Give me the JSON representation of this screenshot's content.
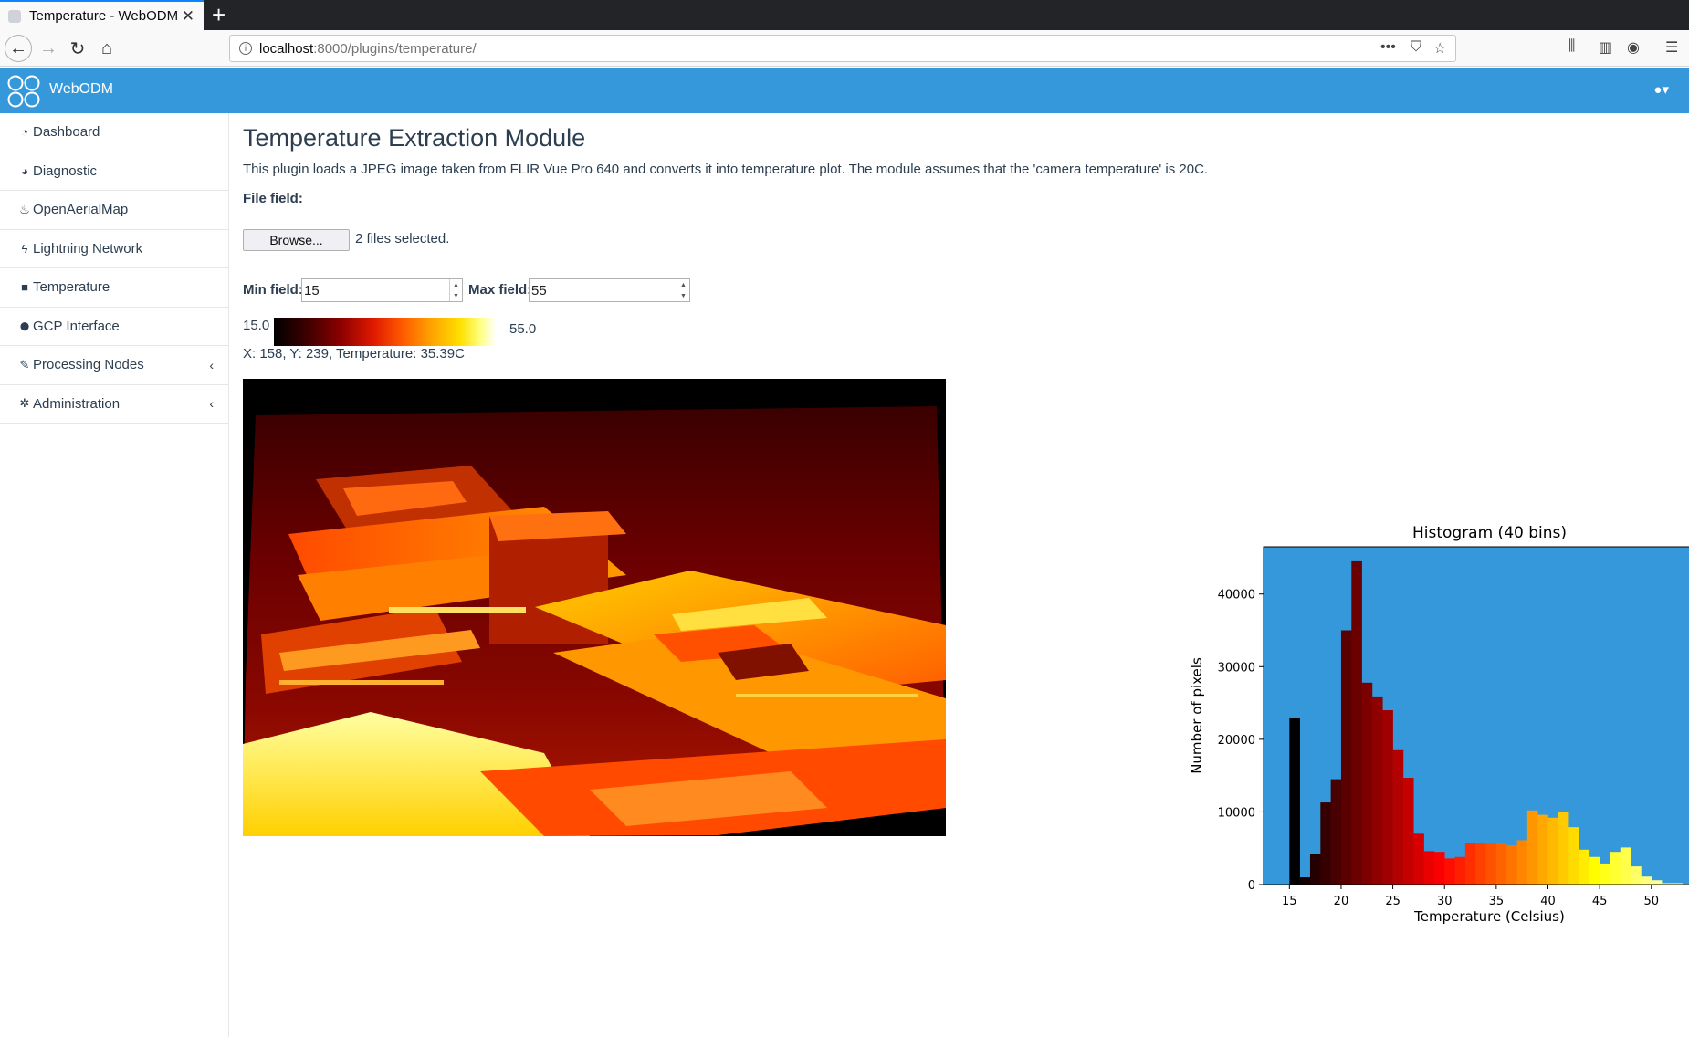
{
  "browser": {
    "tab_title": "Temperature - WebODM",
    "url_host": "localhost",
    "url_path": ":8000/plugins/temperature/"
  },
  "app": {
    "brand": "WebODM"
  },
  "sidebar": {
    "items": [
      {
        "label": "Dashboard",
        "icon": "dashboard-icon",
        "glyph": "◔"
      },
      {
        "label": "Diagnostic",
        "icon": "pie-chart-icon",
        "glyph": "◕"
      },
      {
        "label": "OpenAerialMap",
        "icon": "fire-icon",
        "glyph": "♨"
      },
      {
        "label": "Lightning Network",
        "icon": "bolt-icon",
        "glyph": "ϟ"
      },
      {
        "label": "Temperature",
        "icon": "camera-icon",
        "glyph": "■"
      },
      {
        "label": "GCP Interface",
        "icon": "map-marker-icon",
        "glyph": "⬤"
      },
      {
        "label": "Processing Nodes",
        "icon": "wrench-icon",
        "glyph": "✎",
        "expandable": true
      },
      {
        "label": "Administration",
        "icon": "cogs-icon",
        "glyph": "✲",
        "expandable": true
      }
    ]
  },
  "main": {
    "title": "Temperature Extraction Module",
    "description": "This plugin loads a JPEG image taken from FLIR Vue Pro 640 and converts it into temperature plot. The module assumes that the 'camera temperature' is 20C.",
    "file_label": "File field:",
    "browse_label": "Browse...",
    "files_selected": "2 files selected.",
    "min_label": "Min field:",
    "min_value": "15",
    "max_label": "Max field:",
    "max_value": "55",
    "scale_min": "15.0",
    "scale_max": "55.0",
    "readout": "X: 158, Y: 239, Temperature: 35.39C"
  },
  "chart_data": {
    "type": "bar",
    "title": "Histogram (40 bins)",
    "xlabel": "Temperature (Celsius)",
    "ylabel": "Number of pixels",
    "xlim": [
      12.5,
      56.2
    ],
    "ylim": [
      0,
      46500
    ],
    "xticks": [
      15,
      20,
      25,
      30,
      35,
      40,
      45,
      50
    ],
    "yticks": [
      0,
      10000,
      20000,
      30000,
      40000
    ],
    "background": "#3498db",
    "bins_start": 15,
    "bin_width": 1,
    "values": [
      23000,
      1000,
      4200,
      11300,
      14500,
      35000,
      44500,
      27800,
      25900,
      24000,
      18500,
      14700,
      7000,
      4600,
      4500,
      3600,
      3800,
      5700,
      5700,
      5700,
      5700,
      5400,
      6100,
      10200,
      9600,
      9200,
      10000,
      7900,
      4800,
      3800,
      2900,
      4500,
      5100,
      2500,
      1100,
      600,
      200,
      200,
      100,
      0
    ]
  }
}
